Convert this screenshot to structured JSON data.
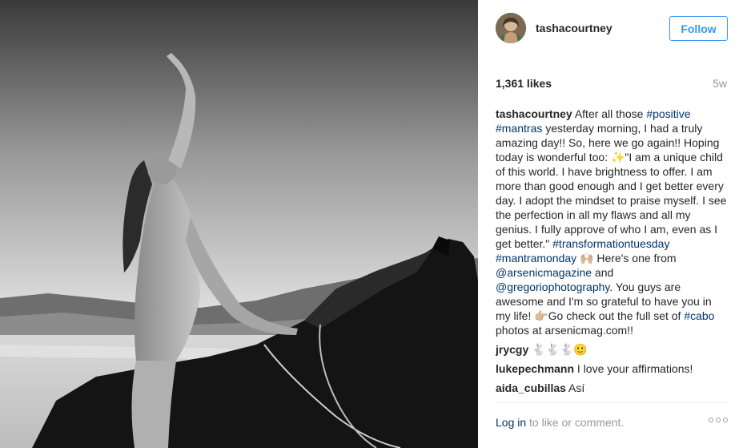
{
  "post": {
    "image_alt": "Black and white photo of a woman riding a dark horse on a beach with her arm raised"
  },
  "header": {
    "username": "tashacourtney",
    "follow_label": "Follow"
  },
  "stats": {
    "likes": "1,361 likes",
    "age": "5w"
  },
  "caption": {
    "author": "tashacourtney",
    "segments": [
      {
        "t": " After all those ",
        "k": "plain"
      },
      {
        "t": "#positive",
        "k": "tag"
      },
      {
        "t": " ",
        "k": "plain"
      },
      {
        "t": "#mantras",
        "k": "tag"
      },
      {
        "t": " yesterday morning, I had a truly amazing day!! So, here we go again!! Hoping today is wonderful too: ",
        "k": "plain"
      },
      {
        "t": "✨",
        "k": "emoji"
      },
      {
        "t": "\"I am a unique child of this world. I have brightness to offer. I am more than good enough and I get better every day. I adopt the mindset to praise myself. I see the perfection in all my flaws and all my genius. I fully approve of who I am, even as I get better.\" ",
        "k": "plain"
      },
      {
        "t": "#transformationtuesday",
        "k": "tag"
      },
      {
        "t": " ",
        "k": "plain"
      },
      {
        "t": "#mantramonday",
        "k": "tag"
      },
      {
        "t": " ",
        "k": "plain"
      },
      {
        "t": "🙌🏼",
        "k": "emoji"
      },
      {
        "t": " Here's one from ",
        "k": "plain"
      },
      {
        "t": "@arsenicmagazine",
        "k": "tag"
      },
      {
        "t": " and ",
        "k": "plain"
      },
      {
        "t": "@gregoriophotography",
        "k": "tag"
      },
      {
        "t": ". You guys are awesome and I'm so grateful to have you in my life! ",
        "k": "plain"
      },
      {
        "t": "👉🏼",
        "k": "emoji"
      },
      {
        "t": "Go check out the full set of ",
        "k": "plain"
      },
      {
        "t": "#cabo",
        "k": "tag"
      },
      {
        "t": " photos at arsenicmag.com!!",
        "k": "plain"
      }
    ]
  },
  "comments": [
    {
      "author": "jrycgy",
      "text": " 🐇🐇🐇🙂"
    },
    {
      "author": "lukepechmann",
      "text": " I love your affirmations!"
    },
    {
      "author": "aida_cubillas",
      "text": " Así"
    }
  ],
  "footer": {
    "login_link": "Log in",
    "login_rest": " to like or comment.",
    "more_icon": "more-options-icon"
  },
  "colors": {
    "accent": "#3897f0",
    "link": "#003569",
    "muted": "#999999"
  }
}
